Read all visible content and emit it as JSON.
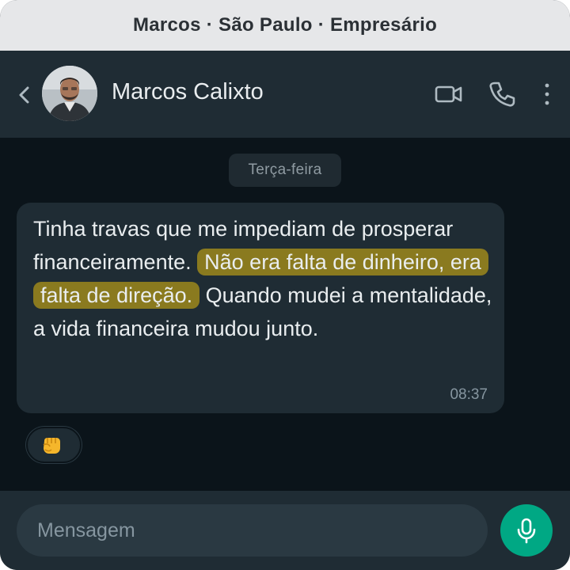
{
  "title_strip": {
    "text": "Marcos · São Paulo · Empresário"
  },
  "header": {
    "back_icon": "chevron-left-icon",
    "contact_name": "Marcos Calixto",
    "icons": [
      "video-camera-icon",
      "phone-icon",
      "more-vertical-icon"
    ]
  },
  "chat": {
    "date_label": "Terça-feira",
    "message": {
      "text_before": "Tinha travas que me impediam de prosperar financeiramente.",
      "text_highlighted": "Não era falta de dinheiro, era falta de direção.",
      "text_after": "Quando mudei a mentalidade, a vida financeira mudou junto.",
      "time": "08:37",
      "highlight_color": "#8a7a1f",
      "reaction": "punch-emoji"
    }
  },
  "composer": {
    "placeholder": "Mensagem",
    "mic_icon": "microphone-icon",
    "mic_color": "#00a884"
  },
  "colors": {
    "header_bg": "#1f2c34",
    "chat_bg": "#0b141a",
    "bubble_bg": "#1f2c34",
    "text": "#e9edef",
    "muted": "#8696a0"
  }
}
